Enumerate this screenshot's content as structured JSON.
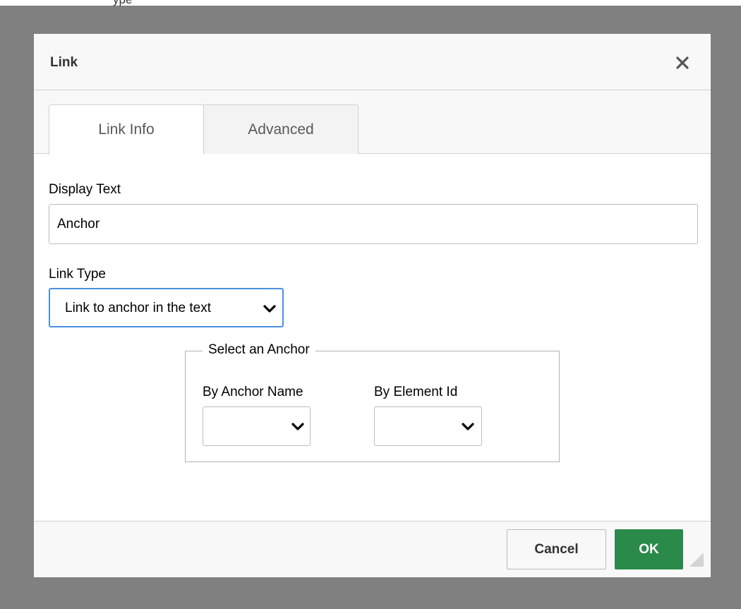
{
  "background_text": "ype",
  "dialog": {
    "title": "Link",
    "close_icon": "close-icon"
  },
  "tabs": [
    {
      "label": "Link Info",
      "active": true
    },
    {
      "label": "Advanced",
      "active": false
    }
  ],
  "form": {
    "display_text_label": "Display Text",
    "display_text_value": "Anchor",
    "link_type_label": "Link Type",
    "link_type_value": "Link to anchor in the text",
    "anchor_group": {
      "legend": "Select an Anchor",
      "by_anchor_name_label": "By Anchor Name",
      "by_anchor_name_value": "",
      "by_element_id_label": "By Element Id",
      "by_element_id_value": ""
    }
  },
  "footer": {
    "cancel_label": "Cancel",
    "ok_label": "OK"
  },
  "colors": {
    "overlay": "#808080",
    "ok_button": "#2a8a4a",
    "focus_border": "#4a90e2"
  }
}
